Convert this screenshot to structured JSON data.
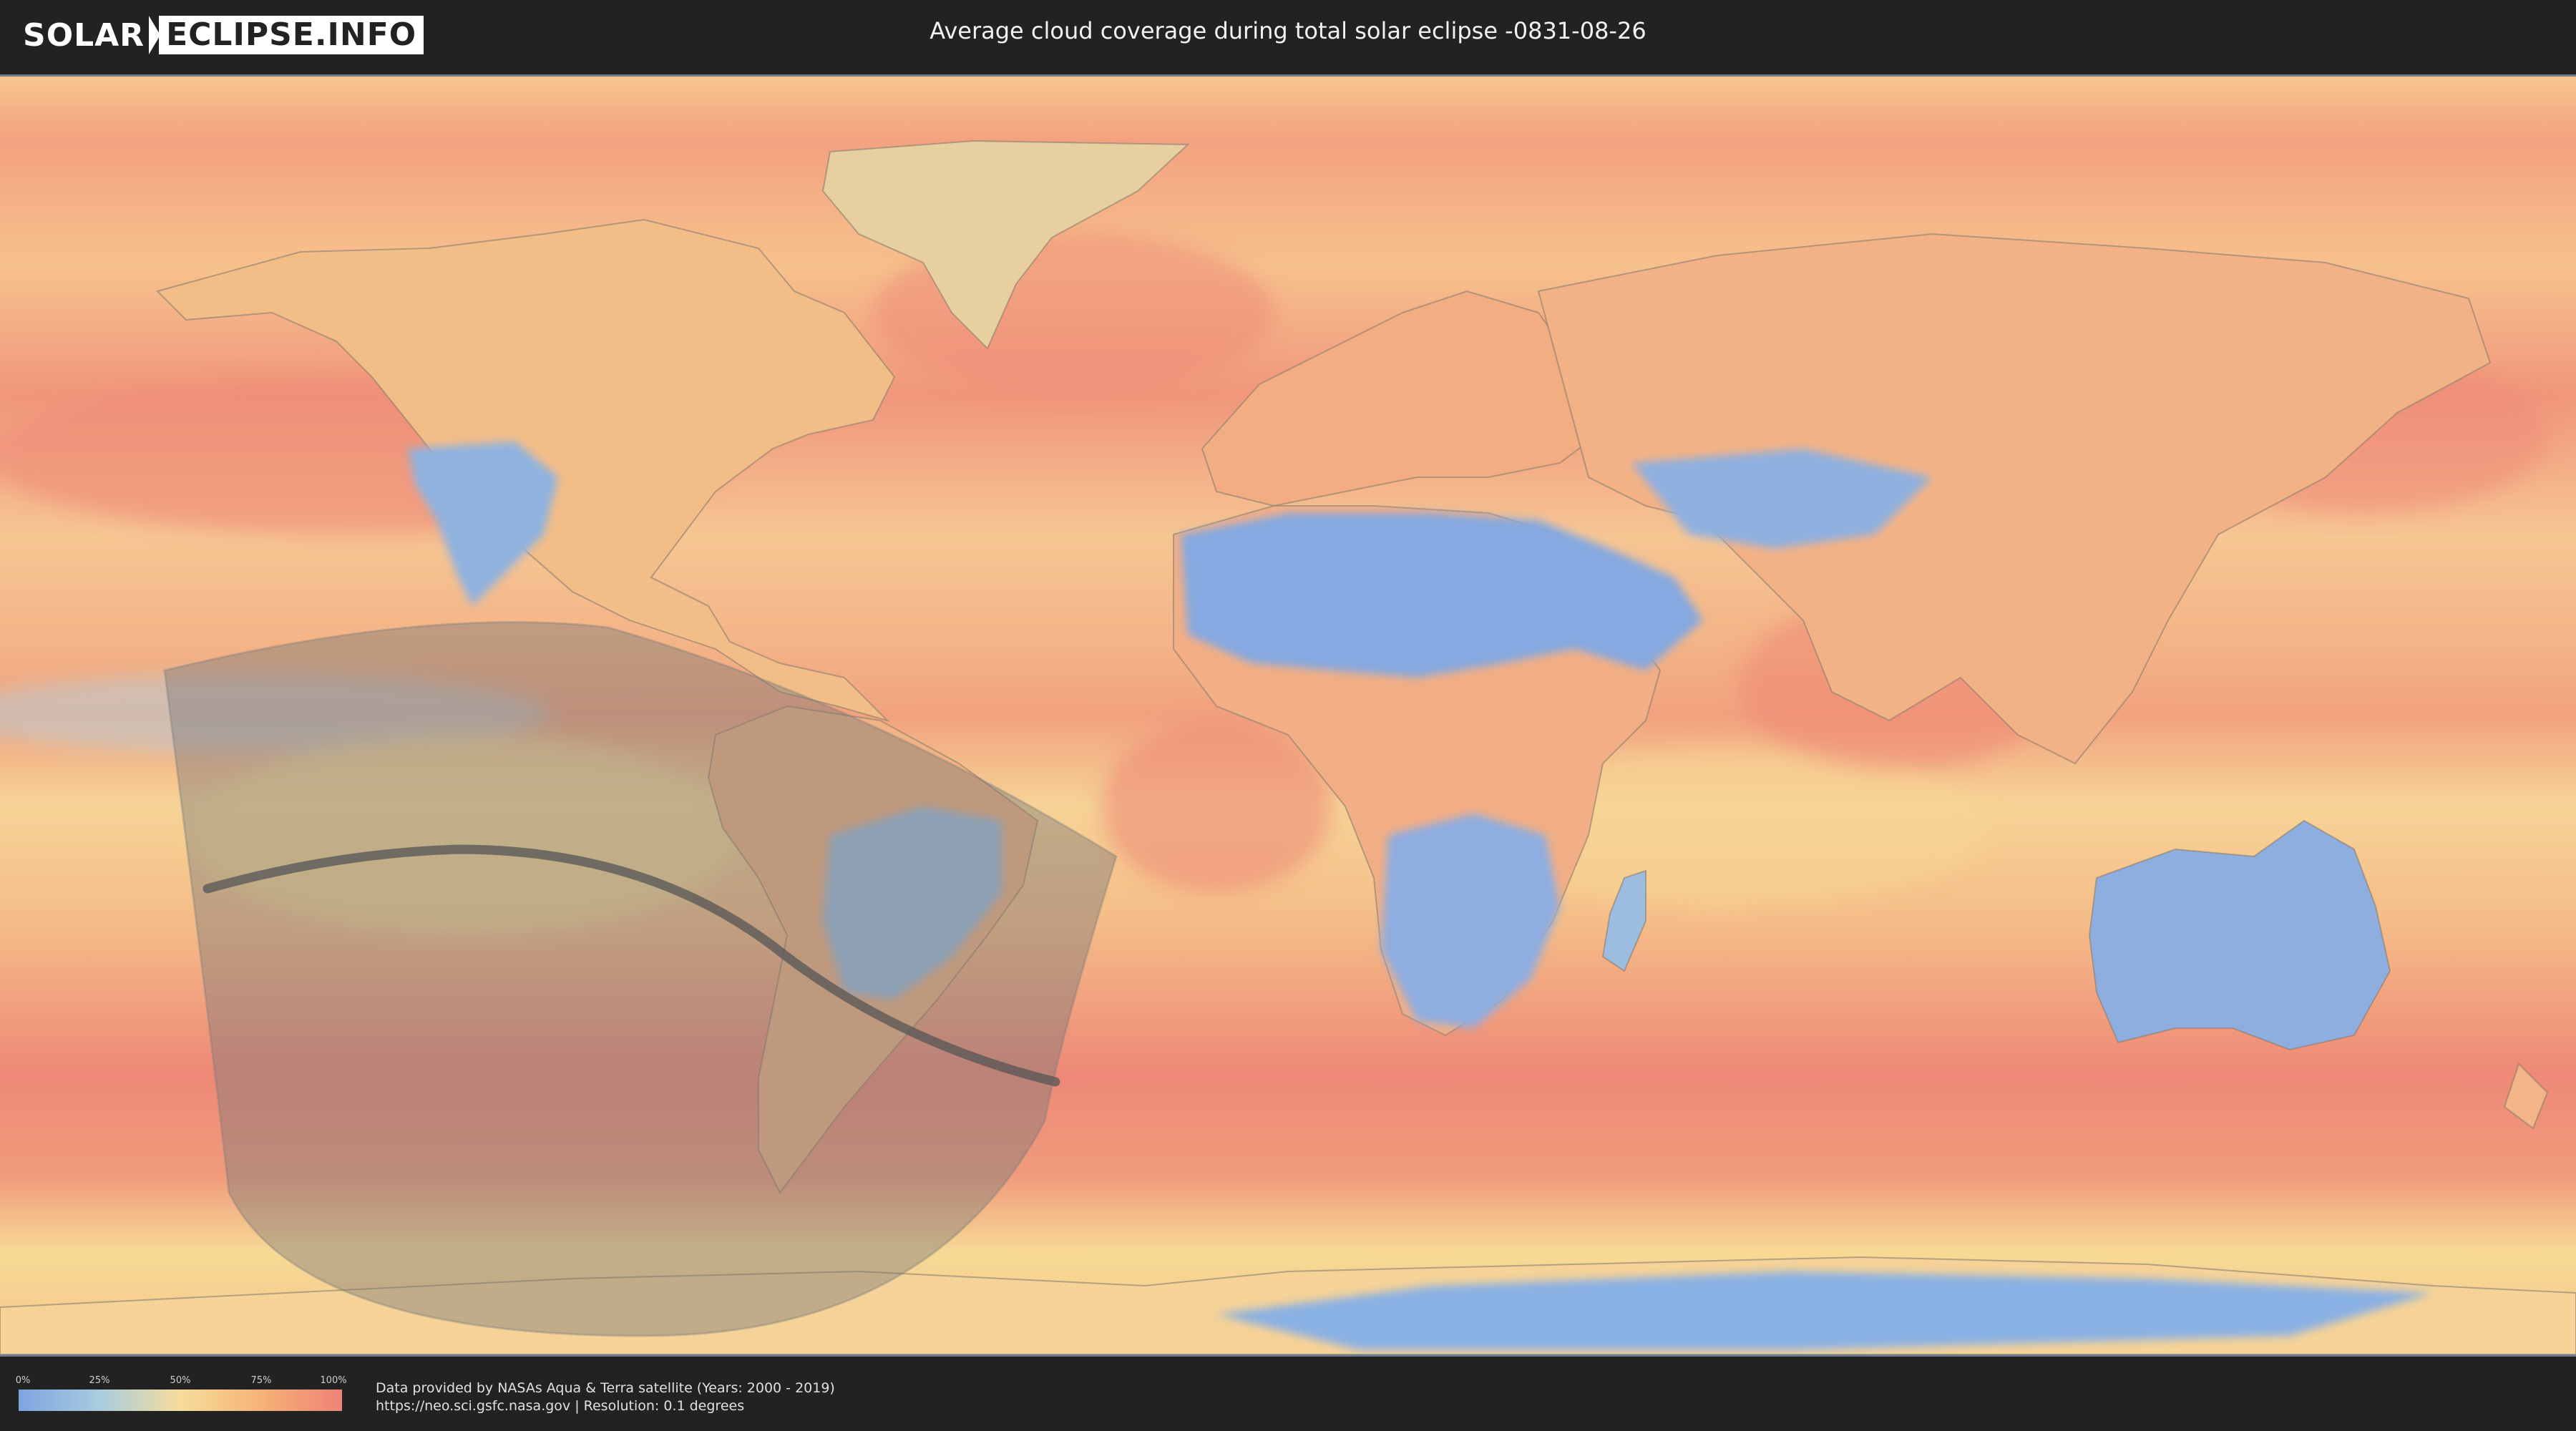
{
  "header": {
    "logo_left": "SOLAR",
    "logo_right": "ECLIPSE.INFO",
    "title": "Average cloud coverage during total solar eclipse -0831-08-26"
  },
  "legend": {
    "ticks": [
      "0%",
      "25%",
      "50%",
      "75%",
      "100%"
    ],
    "colors": [
      "#7ea4e0",
      "#a9ccdf",
      "#f6dd9a",
      "#f6b278",
      "#ee8275"
    ]
  },
  "footer": {
    "line1": "Data provided by NASAs Aqua & Terra satellite (Years: 2000 - 2019)",
    "line2": "https://neo.sci.gsfc.nasa.gov | Resolution: 0.1 degrees"
  },
  "map": {
    "projection": "equirectangular",
    "layers": [
      "cloud-coverage",
      "eclipse-visibility-zone",
      "totality-central-line",
      "country-borders"
    ],
    "colors": {
      "clear": "#7ea4e0",
      "low": "#a9ccdf",
      "mid": "#f6dd9a",
      "high": "#f6b278",
      "overcast": "#ee8275",
      "eclipse_zone": "#777777",
      "central_line": "#555555"
    }
  }
}
